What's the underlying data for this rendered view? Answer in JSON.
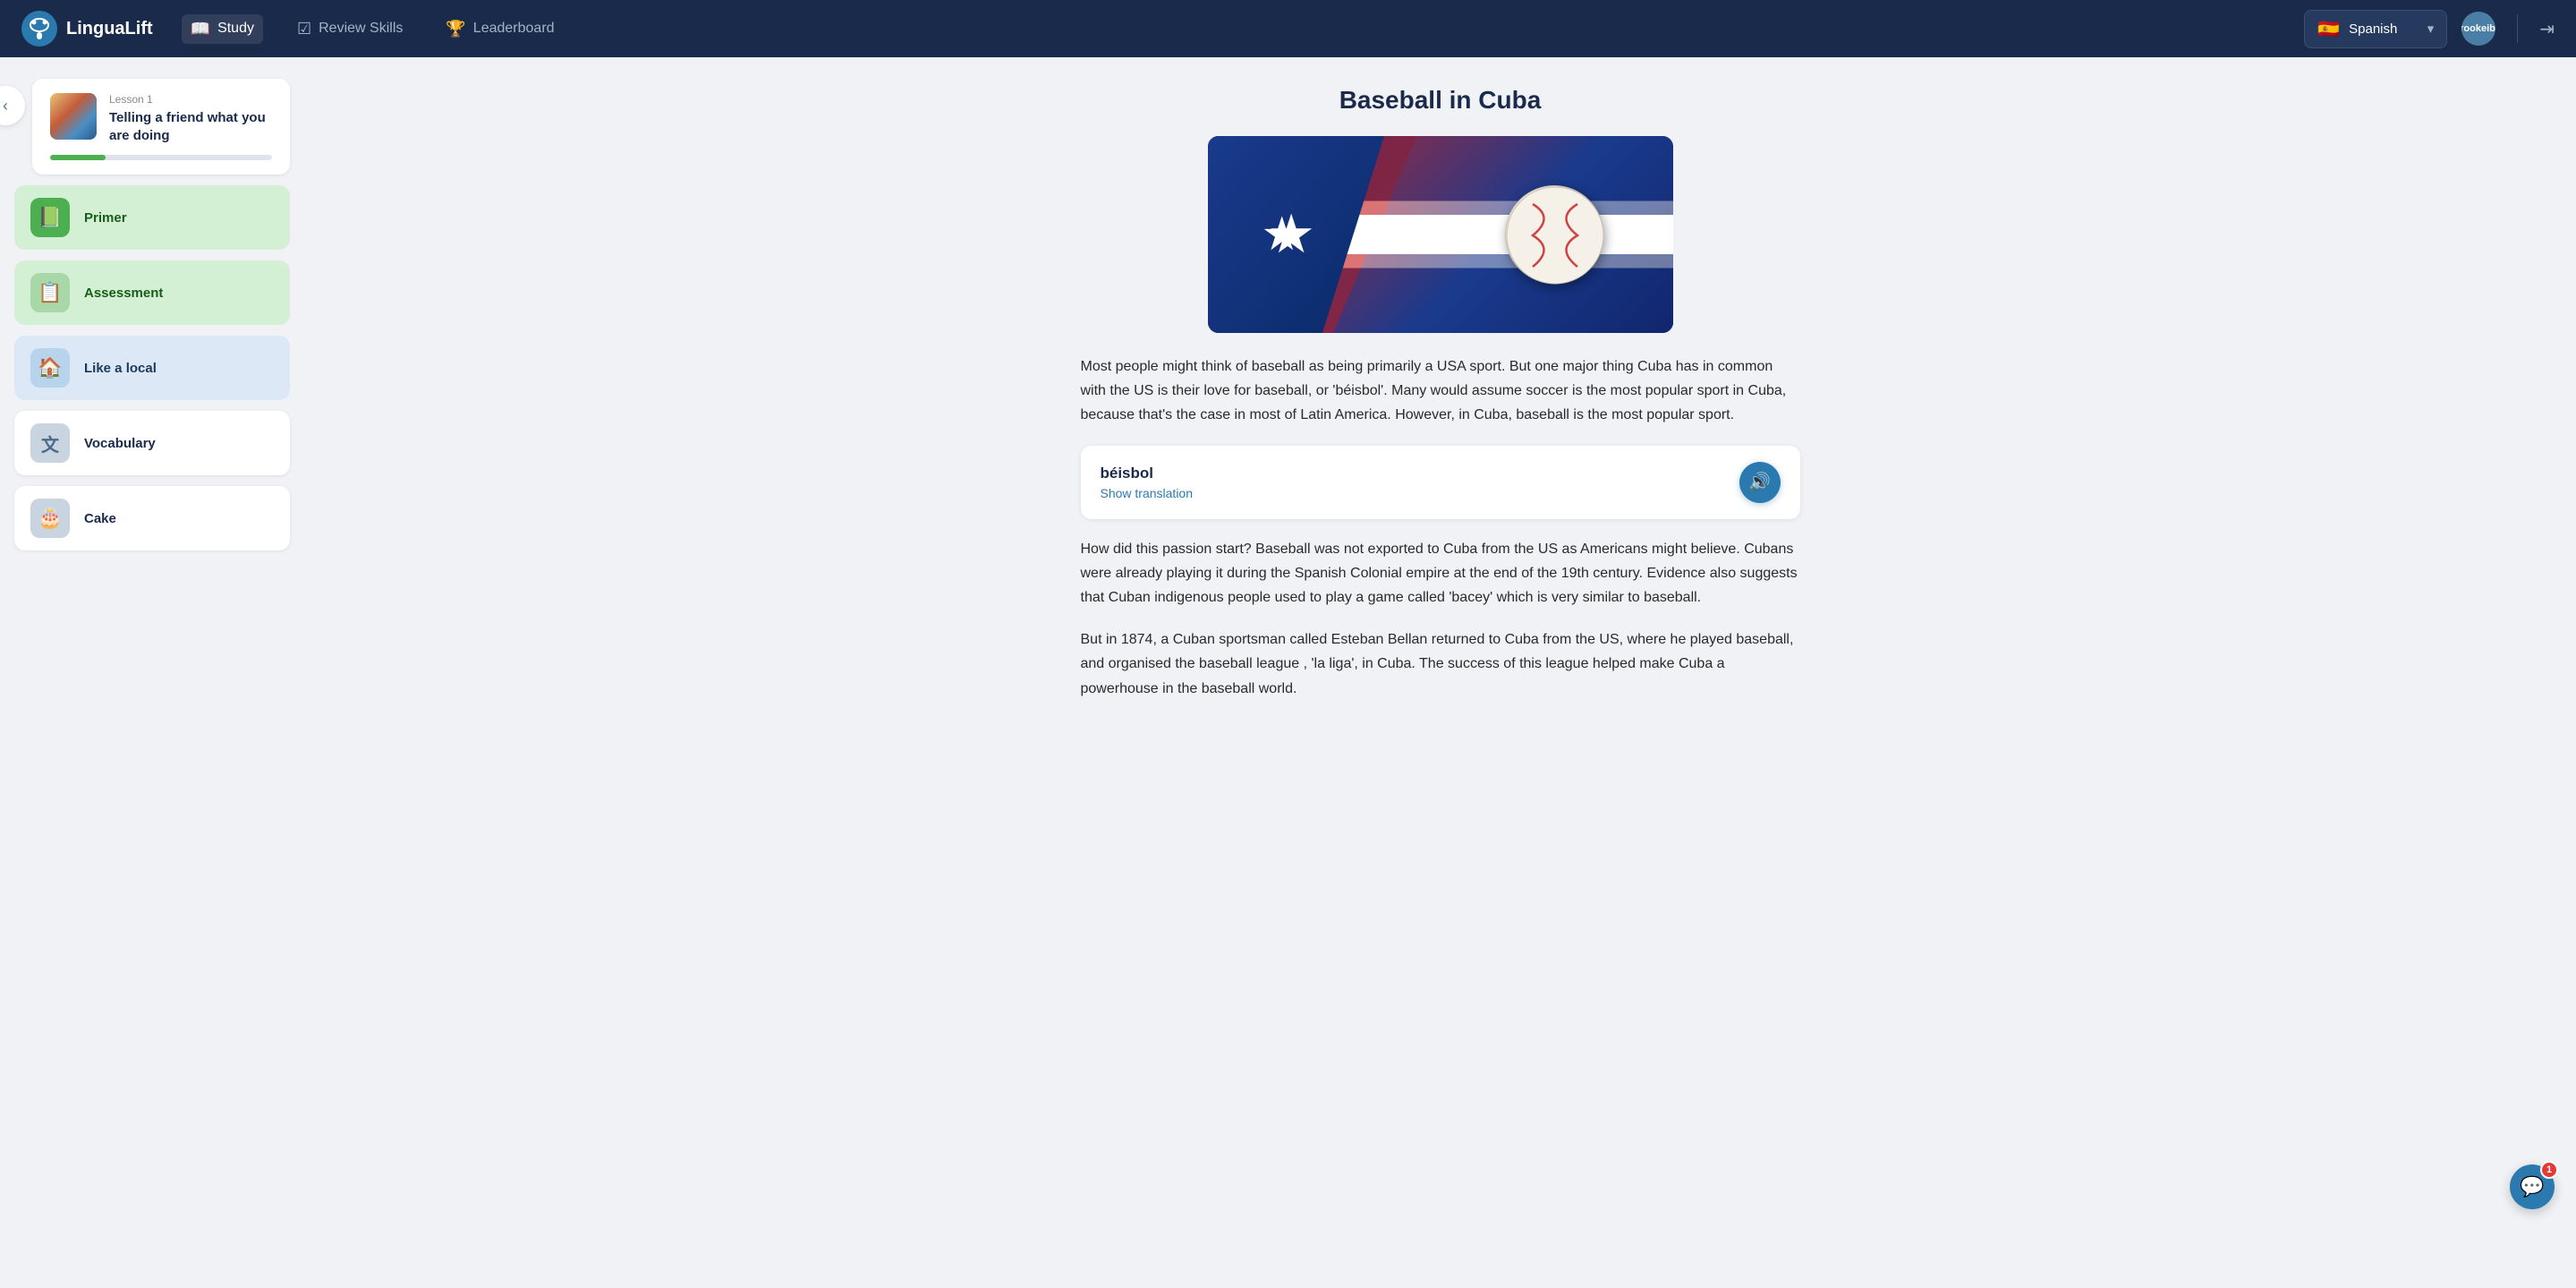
{
  "app": {
    "name": "LinguaLift"
  },
  "navbar": {
    "study_label": "Study",
    "review_skills_label": "Review Skills",
    "leaderboard_label": "Leaderboard",
    "language": "Spanish",
    "username": "brookeib...",
    "flag": "🇪🇸"
  },
  "sidebar": {
    "back_label": "‹",
    "lesson": {
      "number": "Lesson 1",
      "title": "Telling a friend what you are doing",
      "progress_percent": 25
    },
    "items": [
      {
        "id": "primer",
        "label": "Primer",
        "icon": "📗",
        "style": "green"
      },
      {
        "id": "assessment",
        "label": "Assessment",
        "icon": "📋",
        "style": "green"
      },
      {
        "id": "like-a-local",
        "label": "Like a local",
        "icon": "🏠",
        "style": "blue-light"
      },
      {
        "id": "vocabulary",
        "label": "Vocabulary",
        "icon": "🔤",
        "style": "white"
      },
      {
        "id": "cake",
        "label": "Cake",
        "icon": "🎂",
        "style": "white"
      }
    ]
  },
  "article": {
    "title": "Baseball in Cuba",
    "paragraphs": [
      "Most people might think of baseball as being primarily a USA sport. But one major thing Cuba has in common with the US is their love for baseball, or 'béisbol'. Many would assume soccer is the most popular sport in Cuba, because that's the case in most of Latin America. However, in Cuba, baseball is the most popular sport.",
      "How did this passion start? Baseball was not exported to Cuba from the US as Americans might believe. Cubans were already playing it during the Spanish Colonial empire at the end of the 19th century. Evidence also suggests that Cuban indigenous people used to play a game called 'bacey' which is very similar to baseball.",
      "But in 1874, a Cuban sportsman called Esteban Bellan returned to Cuba from the US, where he played baseball, and organised the baseball league , 'la liga', in Cuba. The success of this league helped make Cuba a powerhouse in the baseball world."
    ],
    "vocab_card": {
      "word": "béisbol",
      "translation_link": "Show translation",
      "audio_aria": "Play pronunciation"
    }
  },
  "chat_widget": {
    "badge_count": "1"
  },
  "icons": {
    "back": "‹",
    "chevron_down": "▾",
    "speaker": "🔊",
    "chat": "💬",
    "book": "📖",
    "check": "✓",
    "trophy": "🏆"
  }
}
